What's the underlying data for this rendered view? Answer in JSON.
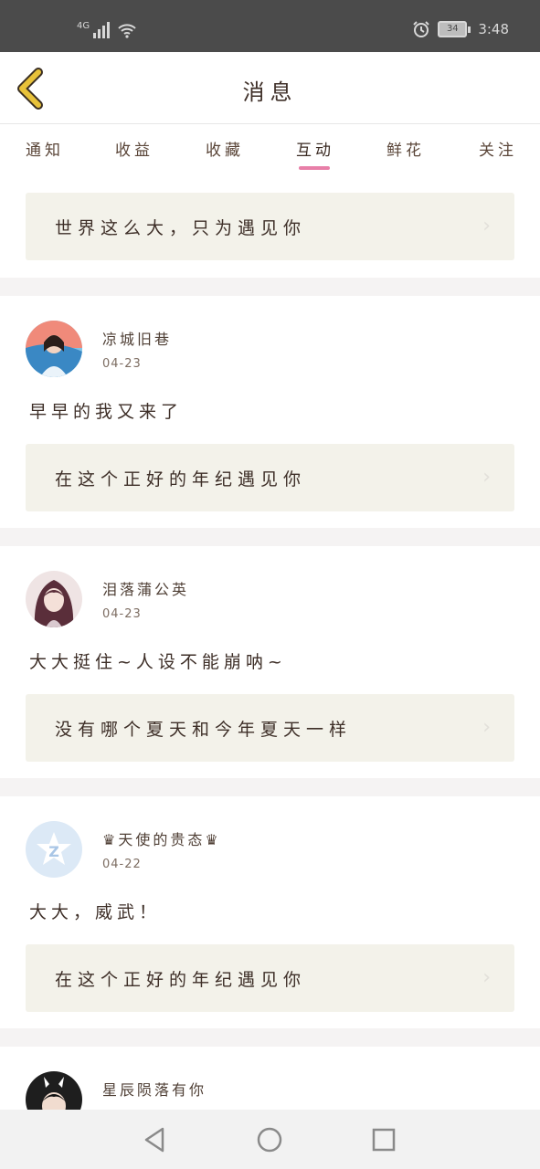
{
  "status_bar": {
    "network": "4G",
    "battery": "34",
    "time": "3:48"
  },
  "header": {
    "title": "消息"
  },
  "tabs": [
    {
      "label": "通知"
    },
    {
      "label": "收益"
    },
    {
      "label": "收藏"
    },
    {
      "label": "互动"
    },
    {
      "label": "鲜花"
    },
    {
      "label": "关注"
    }
  ],
  "active_tab": "互动",
  "top_quote": "世界这么大，只为遇见你",
  "messages": [
    {
      "username": "凉城旧巷",
      "date": "04-23",
      "comment": "早早的我又来了",
      "quote": "在这个正好的年纪遇见你"
    },
    {
      "username": "泪落蒲公英",
      "date": "04-23",
      "comment": "大大挺住~人设不能崩呐~",
      "quote": "没有哪个夏天和今年夏天一样"
    },
    {
      "username": "♛天使的贵态♛",
      "date": "04-22",
      "comment": "大大，威武！",
      "quote": "在这个正好的年纪遇见你"
    },
    {
      "username": "星辰陨落有你"
    }
  ],
  "icons": {
    "back": "chevron-left-icon",
    "chevron": "chevron-right-icon",
    "nav": [
      "back-triangle-icon",
      "home-circle-icon",
      "recents-square-icon"
    ]
  },
  "colors": {
    "accent": "#e87fa8",
    "back_icon": "#e8c23a",
    "quote_bg": "#f3f2ea",
    "separator": "#f5f3f3"
  }
}
